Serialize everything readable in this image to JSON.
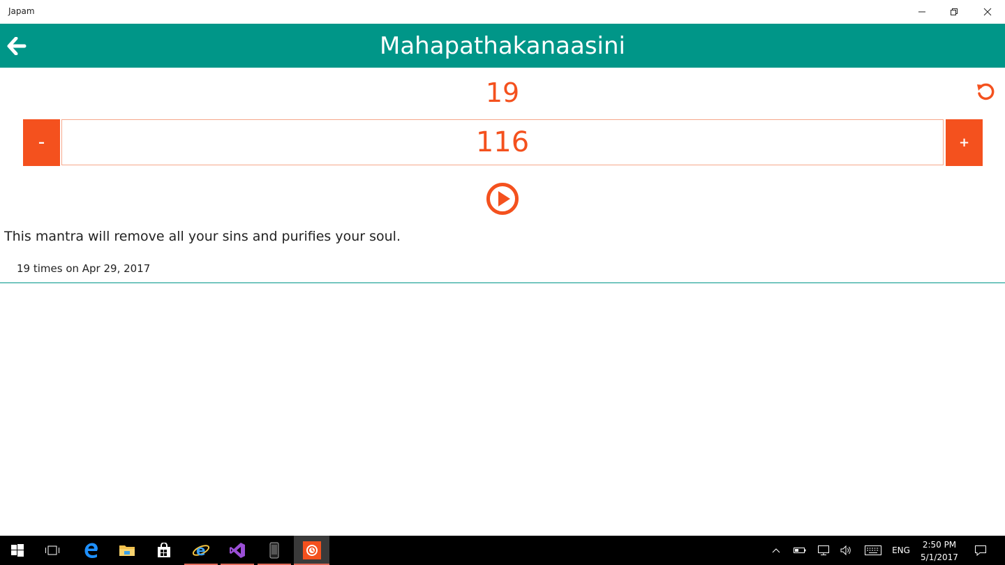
{
  "window": {
    "title": "Japam"
  },
  "header": {
    "title": "Mahapathakanaasini"
  },
  "counter": {
    "current": "19",
    "target": "116",
    "minus_label": "–",
    "plus_label": "+"
  },
  "description": "This mantra will remove all your sins and purifies your soul.",
  "history": [
    "19 times on Apr 29, 2017"
  ],
  "colors": {
    "accent": "#f4511e",
    "header": "#009688"
  },
  "taskbar": {
    "apps": [
      "start-icon",
      "task-view-icon",
      "edge-icon",
      "file-explorer-icon",
      "store-icon",
      "internet-explorer-icon",
      "visual-studio-icon",
      "phone-emulator-icon",
      "japam-app-icon"
    ],
    "language": "ENG",
    "time": "2:50 PM",
    "date": "5/1/2017"
  }
}
